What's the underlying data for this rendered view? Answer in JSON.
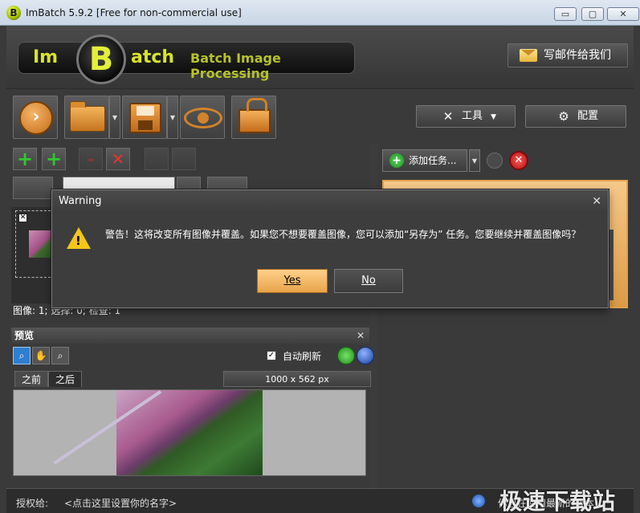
{
  "window": {
    "title": "ImBatch 5.9.2 [Free for non-commercial use]",
    "icon": "B",
    "minimize": "▭",
    "maximize": "▢",
    "close": "✕"
  },
  "header": {
    "logo_im": "Im",
    "logo_b": "B",
    "logo_atch": "atch",
    "tagline": "Batch Image Processing",
    "mail_button": "写邮件给我们"
  },
  "toolbar": {
    "tools_label": "工具",
    "config_label": "配置"
  },
  "left_panel": {
    "status": "图像: 1; 选择: 0; 检查: 1"
  },
  "preview": {
    "title": "预览",
    "auto_refresh_label": "自动刷新",
    "auto_refresh_checked": true,
    "tab_before": "之前",
    "tab_after": "之后",
    "image_size": "1000 x 562 px"
  },
  "right_panel": {
    "add_task_label": "添加任务..."
  },
  "bottombar": {
    "license_label": "授权给:",
    "license_value": "<点击这里设置你的名字>",
    "version_text": "你已在使用最新的版本",
    "watermark": "极速下载站"
  },
  "dialog": {
    "title": "Warning",
    "message": "警告！这将改变所有图像并覆盖。如果您不想要覆盖图像，您可以添加“另存为” 任务。您要继续并覆盖图像吗？",
    "yes_label": "Yes",
    "no_label": "No"
  },
  "colors": {
    "accent": "#e8a44a",
    "logo_yellow": "#d8e42a",
    "warning": "#f5c518"
  }
}
